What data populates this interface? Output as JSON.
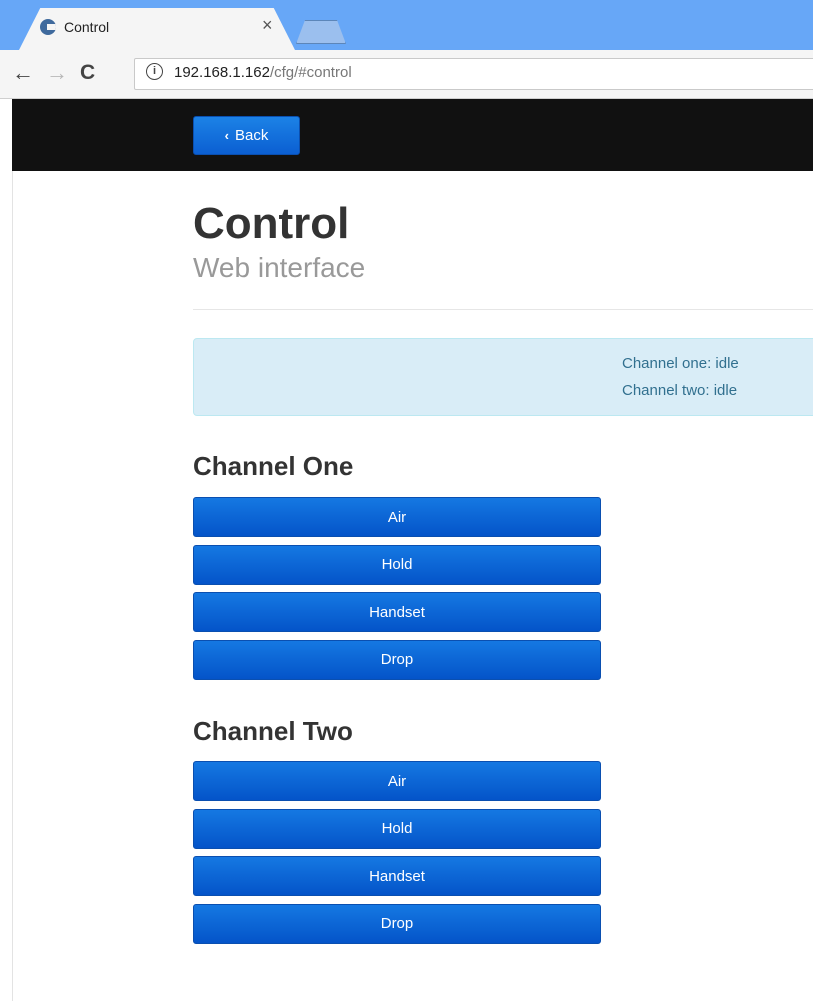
{
  "browser": {
    "tab_title": "Control",
    "close_glyph": "×",
    "url_host": "192.168.1.162",
    "url_path": "/cfg/#control",
    "nav": {
      "back": "←",
      "forward": "→",
      "reload": "C",
      "info": "i"
    }
  },
  "navbar": {
    "back_label": "Back",
    "back_chevron": "‹"
  },
  "page": {
    "title": "Control",
    "subtitle": "Web interface"
  },
  "status": {
    "channel_one": "Channel one: idle",
    "channel_two": "Channel two: idle"
  },
  "channels": [
    {
      "title": "Channel One",
      "buttons": [
        "Air",
        "Hold",
        "Handset",
        "Drop"
      ]
    },
    {
      "title": "Channel Two",
      "buttons": [
        "Air",
        "Hold",
        "Handset",
        "Drop"
      ]
    }
  ],
  "colors": {
    "accent": "#0b5fd2",
    "navbar": "#111111",
    "tabbar": "#67a7f7",
    "alert_bg": "#d9edf7"
  },
  "icons": [
    "back-arrow-icon",
    "forward-arrow-icon",
    "reload-icon",
    "info-icon",
    "close-icon",
    "chevron-left-icon",
    "favicon-icon"
  ]
}
